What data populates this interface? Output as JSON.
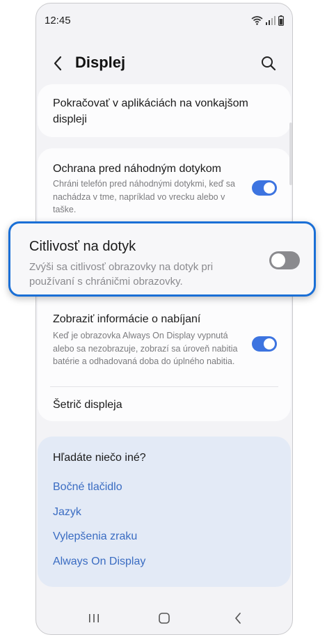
{
  "status_bar": {
    "time": "12:45"
  },
  "header": {
    "title": "Displej"
  },
  "cards": {
    "external": {
      "title": "Pokračovať v aplikáciách na vonkajšom displeji"
    },
    "protection": {
      "title": "Ochrana pred náhodným dotykom",
      "description": "Chráni telefón pred náhodnými dotykmi, keď sa nachádza v tme, napríklad vo vrecku alebo v taške.",
      "toggle_on": true
    },
    "charging": {
      "title": "Zobraziť informácie o nabíjaní",
      "description": "Keď je obrazovka Always On Display vypnutá alebo sa nezobrazuje, zobrazí sa úroveň nabitia batérie a odhadovaná doba do úplného nabitia.",
      "toggle_on": true
    },
    "screensaver": {
      "title": "Šetrič displeja"
    }
  },
  "highlight": {
    "title": "Citlivosť na dotyk",
    "description": "Zvýši sa citlivosť obrazovky na dotyk pri používaní s chráničmi obrazovky.",
    "toggle_on": false
  },
  "suggestions": {
    "title": "Hľadáte niečo iné?",
    "links": [
      "Bočné tlačidlo",
      "Jazyk",
      "Vylepšenia zraku",
      "Always On Display"
    ]
  },
  "colors": {
    "accent": "#3d74e0",
    "highlight_border": "#1a6fd6",
    "link": "#3a6cc2"
  },
  "icons": {
    "back": "chevron-left-icon",
    "search": "search-icon",
    "wifi": "wifi-icon",
    "signal": "signal-icon",
    "battery": "battery-icon",
    "recents": "recents-icon",
    "home": "home-icon",
    "nav_back": "nav-back-icon"
  }
}
